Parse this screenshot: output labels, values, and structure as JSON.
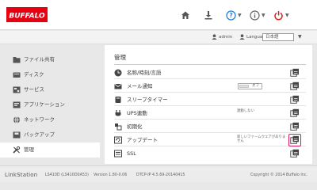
{
  "header": {
    "brand": "BUFFALO",
    "help_icon": "help-icon",
    "info_icon": "info-icon",
    "power_icon": "power-icon"
  },
  "userbar": {
    "user": "admin",
    "language_label": "Language",
    "language_value": "日本語"
  },
  "sidebar": {
    "items": [
      {
        "label": "ファイル共有",
        "icon": "folder-icon"
      },
      {
        "label": "ディスク",
        "icon": "disk-icon"
      },
      {
        "label": "サービス",
        "icon": "services-icon"
      },
      {
        "label": "アプリケーション",
        "icon": "application-icon"
      },
      {
        "label": "ネットワーク",
        "icon": "network-icon"
      },
      {
        "label": "バックアップ",
        "icon": "backup-icon"
      },
      {
        "label": "管理",
        "icon": "tools-icon"
      }
    ]
  },
  "main": {
    "title": "管理",
    "rows": [
      {
        "label": "名称/時刻/言語",
        "icon": "clock-icon"
      },
      {
        "label": "メール通知",
        "icon": "mail-icon",
        "toggle_text": "オフ"
      },
      {
        "label": "スリープタイマー",
        "icon": "sleep-icon"
      },
      {
        "label": "UPS連動",
        "icon": "ups-icon",
        "status": "連動しない"
      },
      {
        "label": "初期化",
        "icon": "init-icon"
      },
      {
        "label": "アップデート",
        "icon": "update-icon",
        "status_line1": "新しいファームウェアがありま",
        "status_line2": "せん"
      },
      {
        "label": "SSL",
        "icon": "ssl-icon"
      }
    ]
  },
  "footer": {
    "brand": "LinkStation",
    "model": "LS410D (LS410D0A53)",
    "version": "Version 1.80-0.06",
    "dtcp": "DTCP-IP 4.5.69-20140415",
    "copyright": "Copyright © 2014 Buffalo Inc."
  },
  "colors": {
    "brand_red": "#e60012",
    "help_blue": "#2f7fd3",
    "power_red": "#d42020",
    "highlight": "#e0185a"
  }
}
